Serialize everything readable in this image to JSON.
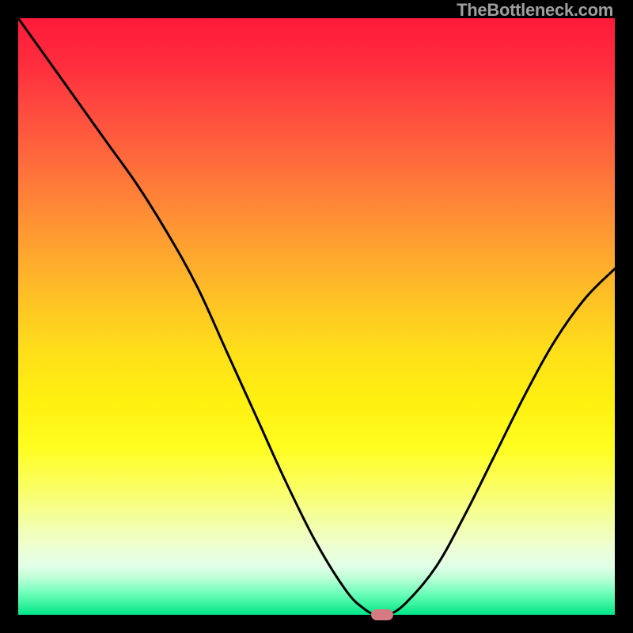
{
  "watermark": "TheBottleneck.com",
  "chart_data": {
    "type": "line",
    "title": "",
    "xlabel": "",
    "ylabel": "",
    "xlim": [
      0,
      100
    ],
    "ylim": [
      0,
      100
    ],
    "x": [
      0,
      5,
      10,
      15,
      20,
      25,
      30,
      35,
      40,
      45,
      50,
      55,
      58,
      60,
      62,
      65,
      70,
      75,
      80,
      85,
      90,
      95,
      100
    ],
    "values": [
      100,
      93,
      86,
      79,
      72,
      64,
      55,
      44,
      33,
      22,
      12,
      4,
      1,
      0,
      0,
      2,
      8,
      17,
      27,
      37,
      46,
      53,
      58
    ],
    "marker": {
      "x": 61,
      "y": 0
    },
    "background_gradient": {
      "top": "#ff1a3a",
      "middle": "#ffdf1a",
      "bottom": "#00e689"
    }
  }
}
